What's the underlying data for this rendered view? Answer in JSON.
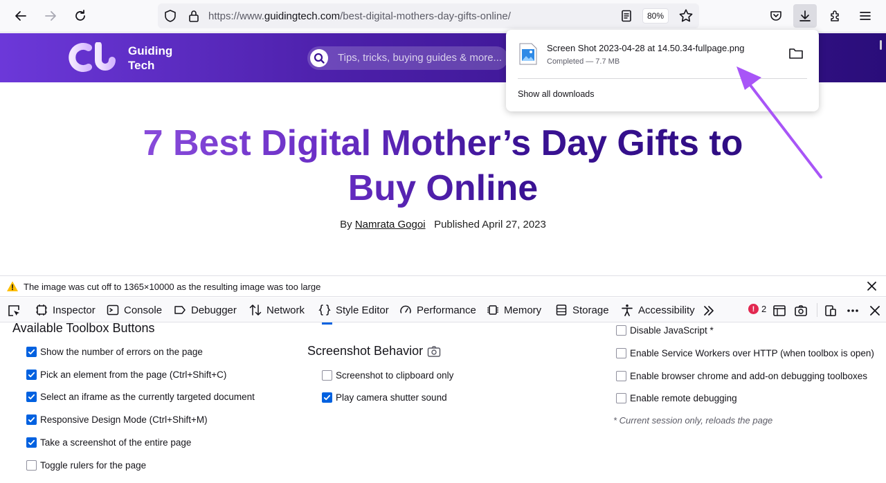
{
  "browser": {
    "url_prefix": "https://www.",
    "url_host": "guidingtech.com",
    "url_path": "/best-digital-mothers-day-gifts-online/",
    "zoom": "80%"
  },
  "site": {
    "logo_line1": "Guiding",
    "logo_line2": "Tech",
    "search_placeholder": "Tips, tricks, buying guides & more..."
  },
  "article": {
    "title_line1": "7 Best Digital Mother’s Day Gifts to",
    "title_line2": "Buy Online",
    "by_label": "By",
    "author": "Namrata Gogoi",
    "published": "Published April 27, 2023"
  },
  "downloads": {
    "file_name": "Screen Shot 2023-04-28 at 14.50.34-fullpage.png",
    "status": "Completed — 7.7 MB",
    "show_all": "Show all downloads"
  },
  "notification": {
    "text": "The image was cut off to 1365×10000 as the resulting image was too large"
  },
  "devtools": {
    "tabs": [
      "Inspector",
      "Console",
      "Debugger",
      "Network",
      "Style Editor",
      "Performance",
      "Memory",
      "Storage",
      "Accessibility"
    ],
    "error_count": "2"
  },
  "settings": {
    "toolbox_heading": "Available Toolbox Buttons",
    "toolbox_options": [
      {
        "label": "Show the number of errors on the page",
        "checked": true
      },
      {
        "label": "Pick an element from the page (Ctrl+Shift+C)",
        "checked": true
      },
      {
        "label": "Select an iframe as the currently targeted document",
        "checked": true
      },
      {
        "label": "Responsive Design Mode (Ctrl+Shift+M)",
        "checked": true
      },
      {
        "label": "Take a screenshot of the entire page",
        "checked": true
      },
      {
        "label": "Toggle rulers for the page",
        "checked": false
      }
    ],
    "screenshot_heading": "Screenshot Behavior",
    "screenshot_options": [
      {
        "label": "Screenshot to clipboard only",
        "checked": false
      },
      {
        "label": "Play camera shutter sound",
        "checked": true
      }
    ],
    "advanced_options": [
      {
        "label": "Disable JavaScript *",
        "checked": false
      },
      {
        "label": "Enable Service Workers over HTTP (when toolbox is open)",
        "checked": false
      },
      {
        "label": "Enable browser chrome and add-on debugging toolboxes",
        "checked": false
      },
      {
        "label": "Enable remote debugging",
        "checked": false
      }
    ],
    "note": "* Current session only, reloads the page"
  },
  "colors": {
    "accent": "#0061e0",
    "brand_purple": "#4b1fa8",
    "annotation_arrow": "#a855f7",
    "error": "#e22850"
  }
}
